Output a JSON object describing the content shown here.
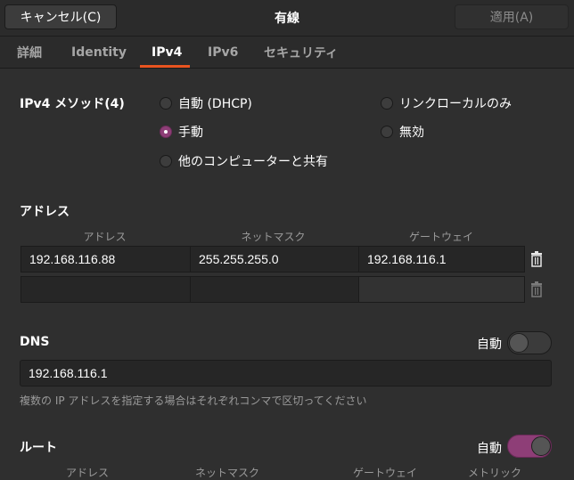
{
  "header": {
    "cancel_label": "キャンセル(C)",
    "title": "有線",
    "apply_label": "適用(A)"
  },
  "tabs": [
    {
      "label": "詳細",
      "active": false
    },
    {
      "label": "Identity",
      "active": false
    },
    {
      "label": "IPv4",
      "active": true
    },
    {
      "label": "IPv6",
      "active": false
    },
    {
      "label": "セキュリティ",
      "active": false
    }
  ],
  "method": {
    "label": "IPv4 メソッド(4)",
    "options": [
      {
        "label": "自動 (DHCP)",
        "checked": false
      },
      {
        "label": "リンクローカルのみ",
        "checked": false
      },
      {
        "label": "手動",
        "checked": true
      },
      {
        "label": "無効",
        "checked": false
      },
      {
        "label": "他のコンピューターと共有",
        "checked": false
      }
    ]
  },
  "addresses": {
    "section_label": "アドレス",
    "columns": [
      "アドレス",
      "ネットマスク",
      "ゲートウェイ"
    ],
    "rows": [
      [
        "192.168.116.88",
        "255.255.255.0",
        "192.168.116.1"
      ],
      [
        "",
        "",
        ""
      ]
    ]
  },
  "dns": {
    "section_label": "DNS",
    "auto_label": "自動",
    "auto_enabled": false,
    "value": "192.168.116.1",
    "hint": "複数の IP アドレスを指定する場合はそれぞれコンマで区切ってください"
  },
  "routes": {
    "section_label": "ルート",
    "auto_label": "自動",
    "auto_enabled": true,
    "columns": [
      "アドレス",
      "ネットマスク",
      "ゲートウェイ",
      "メトリック"
    ]
  },
  "colors": {
    "accent": "#e95420",
    "radio_checked": "#8e3e77",
    "switch_on": "#8e3e77",
    "background": "#2f2f2f"
  }
}
